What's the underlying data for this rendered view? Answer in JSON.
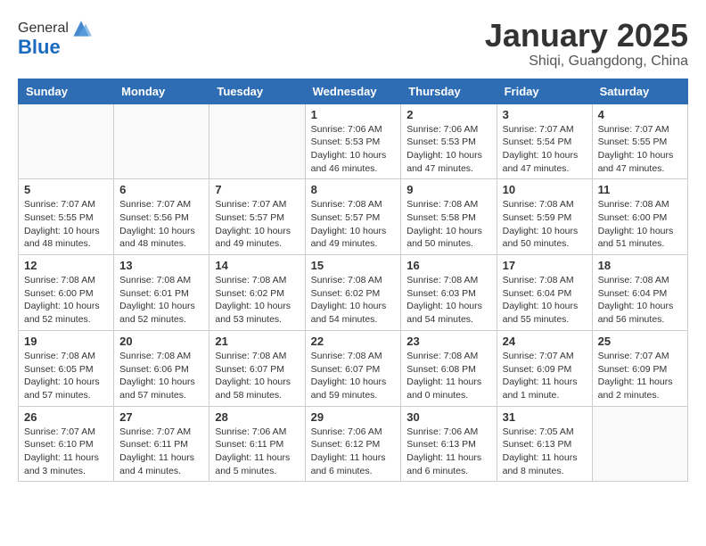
{
  "header": {
    "logo_general": "General",
    "logo_blue": "Blue",
    "month_title": "January 2025",
    "location": "Shiqi, Guangdong, China"
  },
  "days_of_week": [
    "Sunday",
    "Monday",
    "Tuesday",
    "Wednesday",
    "Thursday",
    "Friday",
    "Saturday"
  ],
  "weeks": [
    [
      {
        "day": "",
        "info": ""
      },
      {
        "day": "",
        "info": ""
      },
      {
        "day": "",
        "info": ""
      },
      {
        "day": "1",
        "info": "Sunrise: 7:06 AM\nSunset: 5:53 PM\nDaylight: 10 hours\nand 46 minutes."
      },
      {
        "day": "2",
        "info": "Sunrise: 7:06 AM\nSunset: 5:53 PM\nDaylight: 10 hours\nand 47 minutes."
      },
      {
        "day": "3",
        "info": "Sunrise: 7:07 AM\nSunset: 5:54 PM\nDaylight: 10 hours\nand 47 minutes."
      },
      {
        "day": "4",
        "info": "Sunrise: 7:07 AM\nSunset: 5:55 PM\nDaylight: 10 hours\nand 47 minutes."
      }
    ],
    [
      {
        "day": "5",
        "info": "Sunrise: 7:07 AM\nSunset: 5:55 PM\nDaylight: 10 hours\nand 48 minutes."
      },
      {
        "day": "6",
        "info": "Sunrise: 7:07 AM\nSunset: 5:56 PM\nDaylight: 10 hours\nand 48 minutes."
      },
      {
        "day": "7",
        "info": "Sunrise: 7:07 AM\nSunset: 5:57 PM\nDaylight: 10 hours\nand 49 minutes."
      },
      {
        "day": "8",
        "info": "Sunrise: 7:08 AM\nSunset: 5:57 PM\nDaylight: 10 hours\nand 49 minutes."
      },
      {
        "day": "9",
        "info": "Sunrise: 7:08 AM\nSunset: 5:58 PM\nDaylight: 10 hours\nand 50 minutes."
      },
      {
        "day": "10",
        "info": "Sunrise: 7:08 AM\nSunset: 5:59 PM\nDaylight: 10 hours\nand 50 minutes."
      },
      {
        "day": "11",
        "info": "Sunrise: 7:08 AM\nSunset: 6:00 PM\nDaylight: 10 hours\nand 51 minutes."
      }
    ],
    [
      {
        "day": "12",
        "info": "Sunrise: 7:08 AM\nSunset: 6:00 PM\nDaylight: 10 hours\nand 52 minutes."
      },
      {
        "day": "13",
        "info": "Sunrise: 7:08 AM\nSunset: 6:01 PM\nDaylight: 10 hours\nand 52 minutes."
      },
      {
        "day": "14",
        "info": "Sunrise: 7:08 AM\nSunset: 6:02 PM\nDaylight: 10 hours\nand 53 minutes."
      },
      {
        "day": "15",
        "info": "Sunrise: 7:08 AM\nSunset: 6:02 PM\nDaylight: 10 hours\nand 54 minutes."
      },
      {
        "day": "16",
        "info": "Sunrise: 7:08 AM\nSunset: 6:03 PM\nDaylight: 10 hours\nand 54 minutes."
      },
      {
        "day": "17",
        "info": "Sunrise: 7:08 AM\nSunset: 6:04 PM\nDaylight: 10 hours\nand 55 minutes."
      },
      {
        "day": "18",
        "info": "Sunrise: 7:08 AM\nSunset: 6:04 PM\nDaylight: 10 hours\nand 56 minutes."
      }
    ],
    [
      {
        "day": "19",
        "info": "Sunrise: 7:08 AM\nSunset: 6:05 PM\nDaylight: 10 hours\nand 57 minutes."
      },
      {
        "day": "20",
        "info": "Sunrise: 7:08 AM\nSunset: 6:06 PM\nDaylight: 10 hours\nand 57 minutes."
      },
      {
        "day": "21",
        "info": "Sunrise: 7:08 AM\nSunset: 6:07 PM\nDaylight: 10 hours\nand 58 minutes."
      },
      {
        "day": "22",
        "info": "Sunrise: 7:08 AM\nSunset: 6:07 PM\nDaylight: 10 hours\nand 59 minutes."
      },
      {
        "day": "23",
        "info": "Sunrise: 7:08 AM\nSunset: 6:08 PM\nDaylight: 11 hours\nand 0 minutes."
      },
      {
        "day": "24",
        "info": "Sunrise: 7:07 AM\nSunset: 6:09 PM\nDaylight: 11 hours\nand 1 minute."
      },
      {
        "day": "25",
        "info": "Sunrise: 7:07 AM\nSunset: 6:09 PM\nDaylight: 11 hours\nand 2 minutes."
      }
    ],
    [
      {
        "day": "26",
        "info": "Sunrise: 7:07 AM\nSunset: 6:10 PM\nDaylight: 11 hours\nand 3 minutes."
      },
      {
        "day": "27",
        "info": "Sunrise: 7:07 AM\nSunset: 6:11 PM\nDaylight: 11 hours\nand 4 minutes."
      },
      {
        "day": "28",
        "info": "Sunrise: 7:06 AM\nSunset: 6:11 PM\nDaylight: 11 hours\nand 5 minutes."
      },
      {
        "day": "29",
        "info": "Sunrise: 7:06 AM\nSunset: 6:12 PM\nDaylight: 11 hours\nand 6 minutes."
      },
      {
        "day": "30",
        "info": "Sunrise: 7:06 AM\nSunset: 6:13 PM\nDaylight: 11 hours\nand 6 minutes."
      },
      {
        "day": "31",
        "info": "Sunrise: 7:05 AM\nSunset: 6:13 PM\nDaylight: 11 hours\nand 8 minutes."
      },
      {
        "day": "",
        "info": ""
      }
    ]
  ]
}
